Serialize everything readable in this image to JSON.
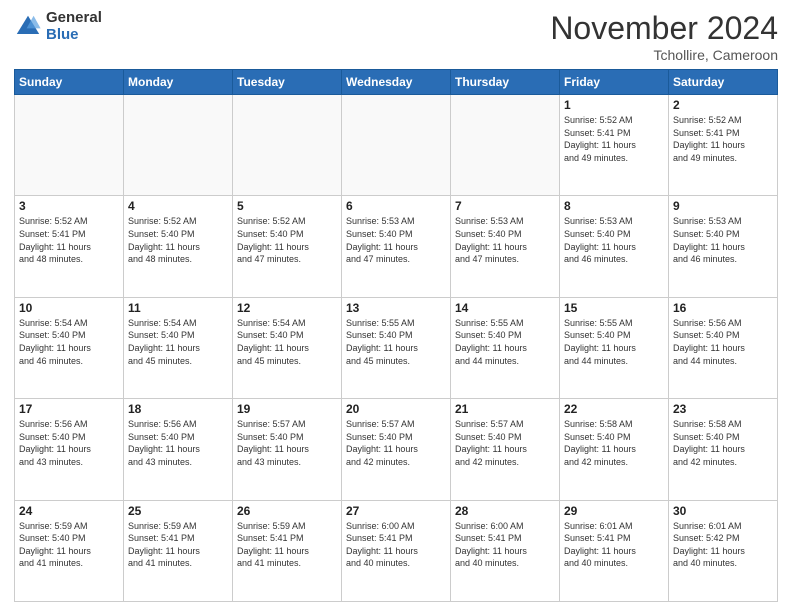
{
  "header": {
    "logo_general": "General",
    "logo_blue": "Blue",
    "month_title": "November 2024",
    "location": "Tchollire, Cameroon"
  },
  "weekdays": [
    "Sunday",
    "Monday",
    "Tuesday",
    "Wednesday",
    "Thursday",
    "Friday",
    "Saturday"
  ],
  "weeks": [
    [
      {
        "day": "",
        "info": ""
      },
      {
        "day": "",
        "info": ""
      },
      {
        "day": "",
        "info": ""
      },
      {
        "day": "",
        "info": ""
      },
      {
        "day": "",
        "info": ""
      },
      {
        "day": "1",
        "info": "Sunrise: 5:52 AM\nSunset: 5:41 PM\nDaylight: 11 hours\nand 49 minutes."
      },
      {
        "day": "2",
        "info": "Sunrise: 5:52 AM\nSunset: 5:41 PM\nDaylight: 11 hours\nand 49 minutes."
      }
    ],
    [
      {
        "day": "3",
        "info": "Sunrise: 5:52 AM\nSunset: 5:41 PM\nDaylight: 11 hours\nand 48 minutes."
      },
      {
        "day": "4",
        "info": "Sunrise: 5:52 AM\nSunset: 5:40 PM\nDaylight: 11 hours\nand 48 minutes."
      },
      {
        "day": "5",
        "info": "Sunrise: 5:52 AM\nSunset: 5:40 PM\nDaylight: 11 hours\nand 47 minutes."
      },
      {
        "day": "6",
        "info": "Sunrise: 5:53 AM\nSunset: 5:40 PM\nDaylight: 11 hours\nand 47 minutes."
      },
      {
        "day": "7",
        "info": "Sunrise: 5:53 AM\nSunset: 5:40 PM\nDaylight: 11 hours\nand 47 minutes."
      },
      {
        "day": "8",
        "info": "Sunrise: 5:53 AM\nSunset: 5:40 PM\nDaylight: 11 hours\nand 46 minutes."
      },
      {
        "day": "9",
        "info": "Sunrise: 5:53 AM\nSunset: 5:40 PM\nDaylight: 11 hours\nand 46 minutes."
      }
    ],
    [
      {
        "day": "10",
        "info": "Sunrise: 5:54 AM\nSunset: 5:40 PM\nDaylight: 11 hours\nand 46 minutes."
      },
      {
        "day": "11",
        "info": "Sunrise: 5:54 AM\nSunset: 5:40 PM\nDaylight: 11 hours\nand 45 minutes."
      },
      {
        "day": "12",
        "info": "Sunrise: 5:54 AM\nSunset: 5:40 PM\nDaylight: 11 hours\nand 45 minutes."
      },
      {
        "day": "13",
        "info": "Sunrise: 5:55 AM\nSunset: 5:40 PM\nDaylight: 11 hours\nand 45 minutes."
      },
      {
        "day": "14",
        "info": "Sunrise: 5:55 AM\nSunset: 5:40 PM\nDaylight: 11 hours\nand 44 minutes."
      },
      {
        "day": "15",
        "info": "Sunrise: 5:55 AM\nSunset: 5:40 PM\nDaylight: 11 hours\nand 44 minutes."
      },
      {
        "day": "16",
        "info": "Sunrise: 5:56 AM\nSunset: 5:40 PM\nDaylight: 11 hours\nand 44 minutes."
      }
    ],
    [
      {
        "day": "17",
        "info": "Sunrise: 5:56 AM\nSunset: 5:40 PM\nDaylight: 11 hours\nand 43 minutes."
      },
      {
        "day": "18",
        "info": "Sunrise: 5:56 AM\nSunset: 5:40 PM\nDaylight: 11 hours\nand 43 minutes."
      },
      {
        "day": "19",
        "info": "Sunrise: 5:57 AM\nSunset: 5:40 PM\nDaylight: 11 hours\nand 43 minutes."
      },
      {
        "day": "20",
        "info": "Sunrise: 5:57 AM\nSunset: 5:40 PM\nDaylight: 11 hours\nand 42 minutes."
      },
      {
        "day": "21",
        "info": "Sunrise: 5:57 AM\nSunset: 5:40 PM\nDaylight: 11 hours\nand 42 minutes."
      },
      {
        "day": "22",
        "info": "Sunrise: 5:58 AM\nSunset: 5:40 PM\nDaylight: 11 hours\nand 42 minutes."
      },
      {
        "day": "23",
        "info": "Sunrise: 5:58 AM\nSunset: 5:40 PM\nDaylight: 11 hours\nand 42 minutes."
      }
    ],
    [
      {
        "day": "24",
        "info": "Sunrise: 5:59 AM\nSunset: 5:40 PM\nDaylight: 11 hours\nand 41 minutes."
      },
      {
        "day": "25",
        "info": "Sunrise: 5:59 AM\nSunset: 5:41 PM\nDaylight: 11 hours\nand 41 minutes."
      },
      {
        "day": "26",
        "info": "Sunrise: 5:59 AM\nSunset: 5:41 PM\nDaylight: 11 hours\nand 41 minutes."
      },
      {
        "day": "27",
        "info": "Sunrise: 6:00 AM\nSunset: 5:41 PM\nDaylight: 11 hours\nand 40 minutes."
      },
      {
        "day": "28",
        "info": "Sunrise: 6:00 AM\nSunset: 5:41 PM\nDaylight: 11 hours\nand 40 minutes."
      },
      {
        "day": "29",
        "info": "Sunrise: 6:01 AM\nSunset: 5:41 PM\nDaylight: 11 hours\nand 40 minutes."
      },
      {
        "day": "30",
        "info": "Sunrise: 6:01 AM\nSunset: 5:42 PM\nDaylight: 11 hours\nand 40 minutes."
      }
    ]
  ]
}
